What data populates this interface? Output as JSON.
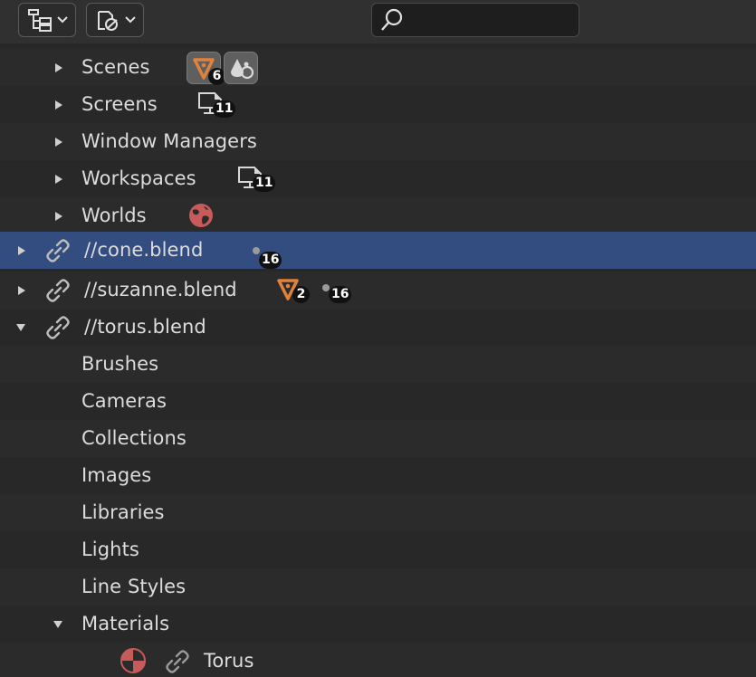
{
  "search": {
    "value": "",
    "placeholder": ""
  },
  "icons": {
    "display_mode": "outliner-tree-icon",
    "filter": "filter-icon",
    "search": "search-icon",
    "library": "link-icon",
    "mesh": "mesh-data-icon",
    "scene": "scene-data-icon",
    "screen": "screen-icon",
    "world": "world-icon",
    "material": "material-icon",
    "object": "object-dot-icon"
  },
  "colors": {
    "selected_row": "#334d80",
    "mesh_orange": "#e0823a",
    "world_red": "#c75a5a",
    "material_red": "#c75a5a"
  },
  "rows": [
    {
      "label": "Scenes",
      "badges": [
        "6"
      ]
    },
    {
      "label": "Screens",
      "badges": [
        "11"
      ]
    },
    {
      "label": "Window Managers",
      "badges": []
    },
    {
      "label": "Workspaces",
      "badges": [
        "11"
      ]
    },
    {
      "label": "Worlds",
      "badges": []
    },
    {
      "label": "//cone.blend",
      "badges": [
        "16"
      ],
      "selected": true
    },
    {
      "label": "//suzanne.blend",
      "badges": [
        "2",
        "16"
      ]
    },
    {
      "label": "//torus.blend",
      "badges": [],
      "expanded": true
    },
    {
      "label": "Brushes"
    },
    {
      "label": "Cameras"
    },
    {
      "label": "Collections"
    },
    {
      "label": "Images"
    },
    {
      "label": "Libraries"
    },
    {
      "label": "Lights"
    },
    {
      "label": "Line Styles"
    },
    {
      "label": "Materials",
      "expanded": true
    },
    {
      "label": "Torus"
    }
  ]
}
